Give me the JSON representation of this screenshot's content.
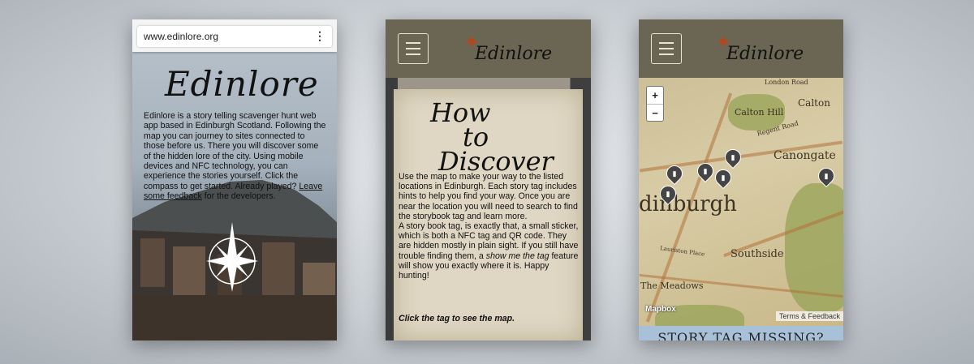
{
  "phone1": {
    "url": "www.edinlore.org",
    "menu_icon": "kebab-menu-icon",
    "logo": "Edinlore",
    "intro_text": "Edinlore is a story telling scavenger hunt web app based in Edinburgh Scotland. Following the map you can journey to sites connected to those before us. There you will discover some of the hidden lore of the city. Using mobile devices and NFC technology, you can experience the stories yourself. Click the compass to get started. Already played? ",
    "feedback_link": "Leave some feedback",
    "intro_tail": " for the developers.",
    "compass_icon": "compass-rose-icon"
  },
  "phone2": {
    "logo": "Edinlore",
    "heading_lines": [
      "How",
      "to",
      "Discover"
    ],
    "paragraph1": "Use the map to make your way to the listed locations in Edinburgh. Each story tag includes hints to help you find your way. Once you are near the location you will need to search to find the storybook tag and learn more.",
    "paragraph2_start": "A story book tag, is exactly that, a small sticker, which is both a NFC tag and QR code. They are hidden mostly in plain sight. If you still have trouble finding them, a ",
    "paragraph2_em": "show me the tag",
    "paragraph2_end": " feature will show you exactly where it is. Happy hunting!",
    "cta": "Click the tag to see the map."
  },
  "phone3": {
    "logo": "Edinlore",
    "zoom_in": "+",
    "zoom_out": "−",
    "labels": [
      "Calton Hill",
      "Calton",
      "Canongate",
      "dinburgh",
      "Southside",
      "The Meadows",
      "London Road",
      "Regent Road",
      "Lauriston Place"
    ],
    "mapbox": "Mapbox",
    "terms": "Terms & Feedback",
    "missing": "STORY TAG MISSING?"
  },
  "colors": {
    "navbar": "#6b6553",
    "paper": "#dfd7c3",
    "pin": "#454545",
    "banner": "#a9c1d8"
  }
}
